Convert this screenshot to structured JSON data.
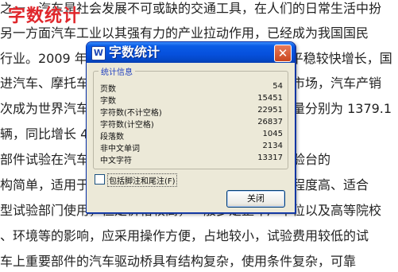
{
  "document": {
    "watermark": "字数统计",
    "lines": [
      "之一，汽车是社会发展不可或缺的交通工具，在人们的日常生活中扮",
      "另一方面汽车工业以其强有力的产业拉动作用，已经成为我国国民",
      "行业。2009 年我国汽车工业取得了历史性的突破，平稳较快增长，国",
      "进汽车、摩托车下乡等政策，有效地激活了汽车消费市场，汽车产销",
      "次成为世界汽车产销第一大国，全年汽车产量和销售量分别为 1379.1",
      "辆，同比增长 48.30% 和 46.15%。",
      "部件试验在汽车研发中占有十分重要的地位，因此试验台的",
      "构简单，适用于各种类型汽车零部件的检测，自动化程度高、适合",
      "型试验部门使用，但是价格较高，一般多是整车厂单位以及高等院校",
      "、环境等的影响，应采用操作方便，占地较小，试验费用较低的试",
      "车上重要部件的汽车驱动桥具有结构复杂，使用条件复杂，可靠"
    ]
  },
  "dialog": {
    "title": "字数统计",
    "close_symbol": "✕",
    "app_icon_letter": "W",
    "group_label": "统计信息",
    "stats": [
      {
        "label": "页数",
        "value": "54"
      },
      {
        "label": "字数",
        "value": "15451"
      },
      {
        "label": "字符数(不计空格)",
        "value": "22951"
      },
      {
        "label": "字符数(计空格)",
        "value": "26837"
      },
      {
        "label": "段落数",
        "value": "1045"
      },
      {
        "label": "非中文单词",
        "value": "2134"
      },
      {
        "label": "中文字符",
        "value": "13317"
      }
    ],
    "checkbox_label": "包括脚注和尾注(F)",
    "checkbox_checked": false,
    "close_button_label": "关闭"
  }
}
